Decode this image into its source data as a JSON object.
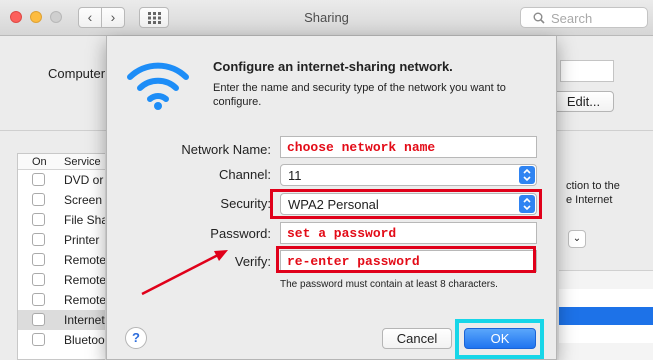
{
  "window": {
    "title": "Sharing",
    "search_placeholder": "Search",
    "back_glyph": "‹",
    "forward_glyph": "›"
  },
  "background": {
    "computer_label": "Computer",
    "edit_button": "Edit...",
    "services_header_on": "On",
    "services_header_service": "Service",
    "services": [
      {
        "label": "DVD or"
      },
      {
        "label": "Screen"
      },
      {
        "label": "File Sha"
      },
      {
        "label": "Printer"
      },
      {
        "label": "Remote"
      },
      {
        "label": "Remote"
      },
      {
        "label": "Remote"
      },
      {
        "label": "Internet"
      },
      {
        "label": "Bluetoo"
      }
    ],
    "right_text": "ction to the\ne Internet",
    "popup_glyph": "⌄"
  },
  "dialog": {
    "heading": "Configure an internet-sharing network.",
    "description": "Enter the name and security type of the network you want to configure.",
    "fields": {
      "network_name_label": "Network Name:",
      "network_name_value": "choose network name",
      "channel_label": "Channel:",
      "channel_value": "11",
      "security_label": "Security:",
      "security_value": "WPA2 Personal",
      "password_label": "Password:",
      "password_value": "set a password",
      "verify_label": "Verify:",
      "verify_value": "re-enter password"
    },
    "hint": "The password must contain at least 8 characters.",
    "help_glyph": "?",
    "cancel_button": "Cancel",
    "ok_button": "OK"
  },
  "colors": {
    "annotation_red": "#e0001a",
    "annotation_cyan": "#17d6e8",
    "field_text_red": "#e30b17",
    "accent_blue": "#1f74f0",
    "wifi_blue": "#1d8df7"
  },
  "icons": {
    "wifi": "wifi-icon",
    "grid": "grid-icon",
    "search": "search-icon",
    "help": "help-icon",
    "stepper": "stepper-arrows-icon"
  }
}
